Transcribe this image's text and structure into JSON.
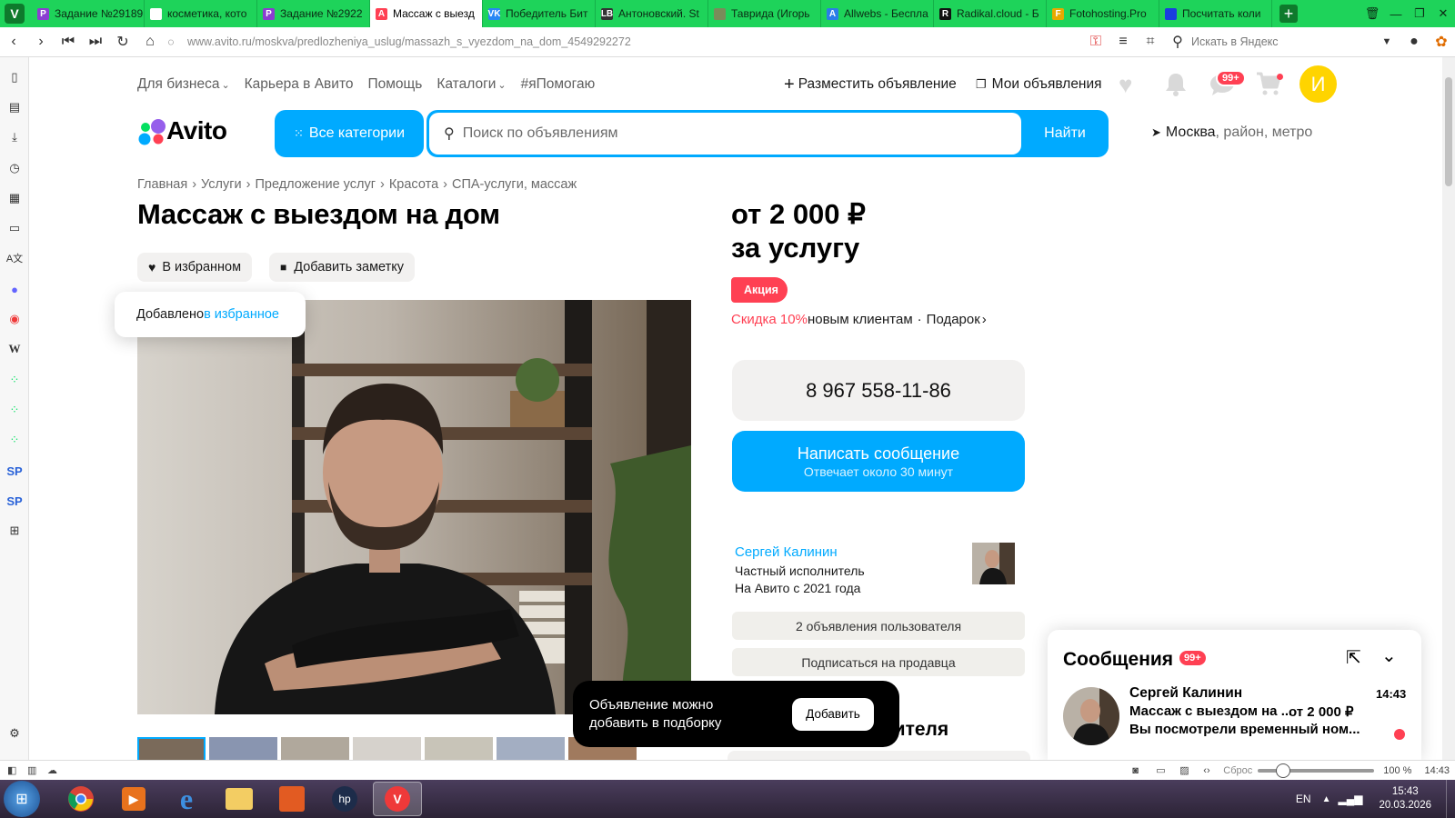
{
  "browser": {
    "tabs": [
      {
        "label": "Задание №29189",
        "fav": "P",
        "color": "#8b3dd1"
      },
      {
        "label": "косметика, кото",
        "fav": "D",
        "color": "#ffffff"
      },
      {
        "label": "Задание №2922",
        "fav": "P",
        "color": "#8b3dd1"
      },
      {
        "label": "Массаж с выезд",
        "fav": "A",
        "color": "#ff4053",
        "active": true
      },
      {
        "label": "Победитель Бит",
        "fav": "VK",
        "color": "#2787f5"
      },
      {
        "label": "Антоновский. St",
        "fav": "LB",
        "color": "#333"
      },
      {
        "label": "Таврида (Игорь",
        "fav": "",
        "color": "#7a8c5a"
      },
      {
        "label": "Allwebs - Беспла",
        "fav": "A",
        "color": "#2b7de9"
      },
      {
        "label": "Radikal.cloud - Б",
        "fav": "R",
        "color": "#111"
      },
      {
        "label": "Fotohosting.Pro",
        "fav": "F",
        "color": "#e8a900"
      },
      {
        "label": "Посчитать коли",
        "fav": "",
        "color": "#1a3ee0"
      }
    ],
    "url": "www.avito.ru/moskva/predlozheniya_uslug/massazh_s_vyezdom_na_dom_4549292272",
    "search_placeholder": "Искать в Яндекс"
  },
  "header": {
    "links": [
      "Для бизнеса",
      "Карьера в Авито",
      "Помощь",
      "Каталоги",
      "#яПомогаю"
    ],
    "post_ad": "Разместить объявление",
    "my_ads": "Мои объявления",
    "messages_badge": "99+",
    "avatar_letter": "И",
    "logo": "Avito",
    "all_categories": "Все категории",
    "search_placeholder": "Поиск по объявлениям",
    "search_button": "Найти",
    "location_city": "Москва",
    "location_rest": ", район, метро"
  },
  "breadcrumbs": [
    "Главная",
    "Услуги",
    "Предложение услуг",
    "Красота",
    "СПА-услуги, массаж"
  ],
  "listing": {
    "title": "Массаж с выездом на дом",
    "favorite_label": "В избранном",
    "note_label": "Добавить заметку",
    "fav_toast_text": "Добавлено ",
    "fav_toast_link": "в избранное",
    "price_line1": "от 2 000 ₽",
    "price_line2": "за услугу",
    "promo_badge": "Акция",
    "discount": "Скидка 10%",
    "discount_rest": " новым клиентам",
    "gift": "Подарок",
    "phone": "8 967 558-11-86",
    "message_button": "Написать сообщение",
    "message_sub": "Отвечает около 30 минут",
    "seller_name": "Сергей Калинин",
    "seller_type": "Частный исполнитель",
    "seller_since": "На Авито с 2021 года",
    "seller_ads": "2 объявления пользователя",
    "subscribe": "Подписаться на продавца",
    "section_heading_partial": "нителя"
  },
  "collection_popup": {
    "text": "Объявление можно добавить в подборку",
    "button": "Добавить"
  },
  "messenger": {
    "title": "Сообщения",
    "badge": "99+",
    "name": "Сергей Калинин",
    "time": "14:43",
    "subject": "Массаж с выездом на ...",
    "price": "от 2 000 ₽",
    "preview": "Вы посмотрели временный ном..."
  },
  "statusbar": {
    "reset": "Сброс",
    "zoom": "100 %",
    "time": "14:43"
  },
  "taskbar": {
    "lang": "EN",
    "time": "15:43",
    "date": "20.03.2026"
  },
  "colors": {
    "accent": "#00aaff",
    "promo": "#ff4053",
    "browser_green": "#1ed35a"
  }
}
